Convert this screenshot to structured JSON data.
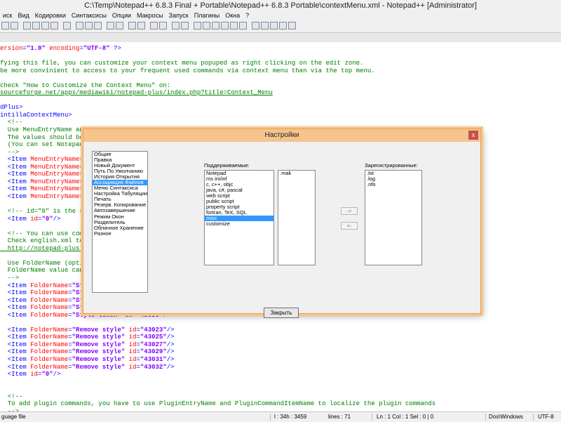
{
  "window": {
    "title": "C:\\Temp\\Notepad++ 6.8.3 Final + Portable\\Notepad++ 6.8.3 Portable\\contextMenu.xml - Notepad++ [Administrator]"
  },
  "menu": [
    "иск",
    "Вид",
    "Кодировки",
    "Синтаксисы",
    "Опции",
    "Макросы",
    "Запуск",
    "Плагины",
    "Окна",
    "?"
  ],
  "editor": {
    "lines": [
      [
        [
          "attr",
          "ersion"
        ],
        [
          "tag",
          "="
        ],
        [
          "val",
          "\"1.0\""
        ],
        [
          "tag",
          " "
        ],
        [
          "attr",
          "encoding"
        ],
        [
          "tag",
          "="
        ],
        [
          "val",
          "\"UTF-8\""
        ],
        [
          "tag",
          " ?>"
        ]
      ],
      [
        [
          "txt",
          ""
        ]
      ],
      [
        [
          "cmt",
          "fying this file, you can customize your context menu popuped as right clicking on the edit zone."
        ]
      ],
      [
        [
          "cmt",
          "be more convinient to access to your frequent used commands via context menu than via the top menu."
        ]
      ],
      [
        [
          "txt",
          ""
        ]
      ],
      [
        [
          "cmt",
          "check \"How to Customize the Context Menu\" on:"
        ]
      ],
      [
        [
          "link",
          "sourceforge.net/apps/mediawiki/notepad-plus/index.php?title=Context_Menu"
        ]
      ],
      [
        [
          "txt",
          ""
        ]
      ],
      [
        [
          "tag",
          "dPlus>"
        ]
      ],
      [
        [
          "tag",
          "intillaContextMenu>"
        ]
      ],
      [
        [
          "cmt",
          "  <!--"
        ]
      ],
      [
        [
          "cmt",
          "  Use MenuEntryName and"
        ]
      ],
      [
        [
          "cmt",
          "  The values should be"
        ]
      ],
      [
        [
          "cmt",
          "  (You can set Notepad"
        ]
      ],
      [
        [
          "cmt",
          "  -->"
        ]
      ],
      [
        [
          "tag",
          "  <Item "
        ],
        [
          "attr",
          "MenuEntryName"
        ],
        [
          "tag",
          "=\""
        ]
      ],
      [
        [
          "tag",
          "  <Item "
        ],
        [
          "attr",
          "MenuEntryName"
        ],
        [
          "tag",
          "=\""
        ]
      ],
      [
        [
          "tag",
          "  <Item "
        ],
        [
          "attr",
          "MenuEntryName"
        ],
        [
          "tag",
          "=\""
        ]
      ],
      [
        [
          "tag",
          "  <Item "
        ],
        [
          "attr",
          "MenuEntryName"
        ],
        [
          "tag",
          "=\""
        ]
      ],
      [
        [
          "tag",
          "  <Item "
        ],
        [
          "attr",
          "MenuEntryName"
        ],
        [
          "tag",
          "=\""
        ]
      ],
      [
        [
          "tag",
          "  <Item "
        ],
        [
          "attr",
          "MenuEntryName"
        ],
        [
          "tag",
          "=\""
        ]
      ],
      [
        [
          "txt",
          ""
        ]
      ],
      [
        [
          "cmt",
          "  <!-- id=\"0\" is the se"
        ]
      ],
      [
        [
          "tag",
          "  <Item "
        ],
        [
          "attr",
          "id"
        ],
        [
          "tag",
          "="
        ],
        [
          "val",
          "\"0\""
        ],
        [
          "tag",
          "/>"
        ]
      ],
      [
        [
          "txt",
          ""
        ]
      ],
      [
        [
          "cmt",
          "  <!-- You can use comm"
        ]
      ],
      [
        [
          "cmt",
          "  Check english.xml to "
        ]
      ],
      [
        [
          "link",
          "  http://notepad-plus.s"
        ]
      ],
      [
        [
          "txt",
          ""
        ]
      ],
      [
        [
          "cmt",
          "  Use FolderName (optio"
        ]
      ],
      [
        [
          "cmt",
          "  FolderName value can "
        ]
      ],
      [
        [
          "cmt",
          "  -->"
        ]
      ],
      [
        [
          "tag",
          "  <Item "
        ],
        [
          "attr",
          "FolderName"
        ],
        [
          "tag",
          "="
        ],
        [
          "val",
          "\"Sty"
        ]
      ],
      [
        [
          "tag",
          "  <Item "
        ],
        [
          "attr",
          "FolderName"
        ],
        [
          "tag",
          "="
        ],
        [
          "val",
          "\"Sty"
        ]
      ],
      [
        [
          "tag",
          "  <Item "
        ],
        [
          "attr",
          "FolderName"
        ],
        [
          "tag",
          "="
        ],
        [
          "val",
          "\"Sty"
        ]
      ],
      [
        [
          "tag",
          "  <Item "
        ],
        [
          "attr",
          "FolderName"
        ],
        [
          "tag",
          "="
        ],
        [
          "val",
          "\"Sty"
        ]
      ],
      [
        [
          "tag",
          "  <Item "
        ],
        [
          "attr",
          "FolderName"
        ],
        [
          "tag",
          "="
        ],
        [
          "val",
          "\"Style token\""
        ],
        [
          "tag",
          " "
        ],
        [
          "attr",
          "id"
        ],
        [
          "tag",
          "="
        ],
        [
          "val",
          "\"43030\""
        ],
        [
          "tag",
          "/>"
        ]
      ],
      [
        [
          "txt",
          ""
        ]
      ],
      [
        [
          "tag",
          "  <Item "
        ],
        [
          "attr",
          "FolderName"
        ],
        [
          "tag",
          "="
        ],
        [
          "val",
          "\"Remove style\""
        ],
        [
          "tag",
          " "
        ],
        [
          "attr",
          "id"
        ],
        [
          "tag",
          "="
        ],
        [
          "val",
          "\"43023\""
        ],
        [
          "tag",
          "/>"
        ]
      ],
      [
        [
          "tag",
          "  <Item "
        ],
        [
          "attr",
          "FolderName"
        ],
        [
          "tag",
          "="
        ],
        [
          "val",
          "\"Remove style\""
        ],
        [
          "tag",
          " "
        ],
        [
          "attr",
          "id"
        ],
        [
          "tag",
          "="
        ],
        [
          "val",
          "\"43025\""
        ],
        [
          "tag",
          "/>"
        ]
      ],
      [
        [
          "tag",
          "  <Item "
        ],
        [
          "attr",
          "FolderName"
        ],
        [
          "tag",
          "="
        ],
        [
          "val",
          "\"Remove style\""
        ],
        [
          "tag",
          " "
        ],
        [
          "attr",
          "id"
        ],
        [
          "tag",
          "="
        ],
        [
          "val",
          "\"43027\""
        ],
        [
          "tag",
          "/>"
        ]
      ],
      [
        [
          "tag",
          "  <Item "
        ],
        [
          "attr",
          "FolderName"
        ],
        [
          "tag",
          "="
        ],
        [
          "val",
          "\"Remove style\""
        ],
        [
          "tag",
          " "
        ],
        [
          "attr",
          "id"
        ],
        [
          "tag",
          "="
        ],
        [
          "val",
          "\"43029\""
        ],
        [
          "tag",
          "/>"
        ]
      ],
      [
        [
          "tag",
          "  <Item "
        ],
        [
          "attr",
          "FolderName"
        ],
        [
          "tag",
          "="
        ],
        [
          "val",
          "\"Remove style\""
        ],
        [
          "tag",
          " "
        ],
        [
          "attr",
          "id"
        ],
        [
          "tag",
          "="
        ],
        [
          "val",
          "\"43031\""
        ],
        [
          "tag",
          "/>"
        ]
      ],
      [
        [
          "tag",
          "  <Item "
        ],
        [
          "attr",
          "FolderName"
        ],
        [
          "tag",
          "="
        ],
        [
          "val",
          "\"Remove style\""
        ],
        [
          "tag",
          " "
        ],
        [
          "attr",
          "id"
        ],
        [
          "tag",
          "="
        ],
        [
          "val",
          "\"43032\""
        ],
        [
          "tag",
          "/>"
        ]
      ],
      [
        [
          "tag",
          "  <Item "
        ],
        [
          "attr",
          "id"
        ],
        [
          "tag",
          "="
        ],
        [
          "val",
          "\"0\""
        ],
        [
          "tag",
          "/>"
        ]
      ],
      [
        [
          "txt",
          ""
        ]
      ],
      [
        [
          "txt",
          ""
        ]
      ],
      [
        [
          "cmt",
          "  <!--"
        ]
      ],
      [
        [
          "cmt",
          "  To add plugin commands, you have to use PluginEntryName and PluginCommandItemName to localize the plugin commands"
        ]
      ],
      [
        [
          "cmt",
          "  -->"
        ]
      ]
    ]
  },
  "status": {
    "language": "guage file",
    "position": "l : 34h : 3459",
    "lines": "lines : 71",
    "cursor": "Ln : 1   Col : 1   Sel : 0 | 0",
    "eol": "Dos\\Windows",
    "encoding": "UTF-8"
  },
  "dialog": {
    "title": "Настройки",
    "close_glyph": "x",
    "categories": [
      {
        "label": "Общие",
        "selected": false
      },
      {
        "label": "Правка",
        "selected": false
      },
      {
        "label": "Новый Документ",
        "selected": false
      },
      {
        "label": "Путь По Умолчанию",
        "selected": false
      },
      {
        "label": "История Открытия",
        "selected": false
      },
      {
        "label": "Ассоциация Файлов",
        "selected": true
      },
      {
        "label": "Меню Синтаксиса",
        "selected": false
      },
      {
        "label": "Настройка Табуляции",
        "selected": false
      },
      {
        "label": "Печать",
        "selected": false
      },
      {
        "label": "Резерв. Копирование",
        "selected": false
      },
      {
        "label": "Автозавершение",
        "selected": false
      },
      {
        "label": "Режим Окон",
        "selected": false
      },
      {
        "label": "Разделитель",
        "selected": false
      },
      {
        "label": "Облачное Хранение",
        "selected": false
      },
      {
        "label": "Разное",
        "selected": false
      }
    ],
    "supported_label": "Поддерживаемые:",
    "supported": [
      {
        "label": "Notepad",
        "selected": false
      },
      {
        "label": "ms ini/inf",
        "selected": false
      },
      {
        "label": "c, c++, objc",
        "selected": false
      },
      {
        "label": "java, c#, pascal",
        "selected": false
      },
      {
        "label": "web script",
        "selected": false
      },
      {
        "label": "public script",
        "selected": false
      },
      {
        "label": "property script",
        "selected": false
      },
      {
        "label": "fortran, TeX, SQL",
        "selected": false
      },
      {
        "label": "misc",
        "selected": true
      },
      {
        "label": "customize",
        "selected": false
      }
    ],
    "extensions": [
      ".mak"
    ],
    "registered_label": "Зарегистрированные:",
    "registered": [
      ".txt",
      ".log",
      ".nfo"
    ],
    "add_button": "->",
    "remove_button": "<-",
    "close_button": "Закрыть"
  }
}
